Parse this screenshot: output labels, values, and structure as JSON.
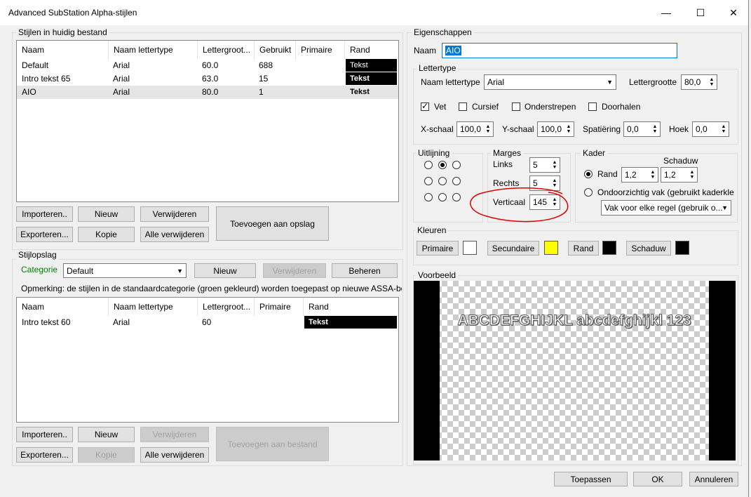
{
  "window": {
    "title": "Advanced SubStation Alpha-stijlen",
    "minimize": "—",
    "maximize": "☐",
    "close": "✕"
  },
  "styles_in_file": {
    "group_label": "Stijlen in huidig bestand",
    "headers": [
      "Naam",
      "Naam lettertype",
      "Lettergroot...",
      "Gebruikt",
      "Primaire",
      "Rand"
    ],
    "rows": [
      {
        "name": "Default",
        "font": "Arial",
        "size": "60.0",
        "used": "688",
        "primary": "",
        "border": "Tekst"
      },
      {
        "name": "Intro tekst 65",
        "font": "Arial",
        "size": "63.0",
        "used": "15",
        "primary": "",
        "border": "Tekst"
      },
      {
        "name": "AIO",
        "font": "Arial",
        "size": "80.0",
        "used": "1",
        "primary": "",
        "border": "Tekst"
      }
    ],
    "buttons": {
      "import": "Importeren..",
      "new": "Nieuw",
      "delete": "Verwijderen",
      "add_to_storage": "Toevoegen aan opslag",
      "export": "Exporteren...",
      "copy": "Kopie",
      "delete_all": "Alle verwijderen"
    }
  },
  "storage": {
    "group_label": "Stijlopslag",
    "category_label": "Categorie",
    "category_value": "Default",
    "new": "Nieuw",
    "delete": "Verwijderen",
    "manage": "Beheren",
    "note": "Opmerking: de stijlen in de standaardcategorie (groen gekleurd) worden toegepast op nieuwe ASSA-bes",
    "headers": [
      "Naam",
      "Naam lettertype",
      "Lettergroot...",
      "Primaire",
      "Rand"
    ],
    "rows": [
      {
        "name": "Intro tekst 60",
        "font": "Arial",
        "size": "60",
        "primary": "",
        "border": "Tekst"
      }
    ],
    "buttons": {
      "import": "Importeren..",
      "new": "Nieuw",
      "delete": "Verwijderen",
      "add_to_file": "Toevoegen aan bestand",
      "export": "Exporteren...",
      "copy": "Kopie",
      "delete_all": "Alle verwijderen"
    }
  },
  "properties": {
    "group_label": "Eigenschappen",
    "name_label": "Naam",
    "name_value": "AIO",
    "font": {
      "group_label": "Lettertype",
      "font_name_label": "Naam lettertype",
      "font_name_value": "Arial",
      "font_size_label": "Lettergrootte",
      "font_size_value": "80,0",
      "bold": "Vet",
      "italic": "Cursief",
      "underline": "Onderstrepen",
      "strikeout": "Doorhalen",
      "x_scale_label": "X-schaal",
      "x_scale_value": "100,0",
      "y_scale_label": "Y-schaal",
      "y_scale_value": "100,0",
      "spacing_label": "Spatiëring",
      "spacing_value": "0,0",
      "angle_label": "Hoek",
      "angle_value": "0,0"
    },
    "alignment": {
      "group_label": "Uitlijning"
    },
    "margins": {
      "group_label": "Marges",
      "left_label": "Links",
      "left_value": "5",
      "right_label": "Rechts",
      "right_value": "5",
      "vertical_label": "Verticaal",
      "vertical_value": "145"
    },
    "border": {
      "group_label": "Kader",
      "shadow_label": "Schaduw",
      "outline_label": "Rand",
      "outline_value": "1,2",
      "shadow_value": "1,2",
      "opaque_label": "Ondoorzichtig vak (gebruikt kaderkle",
      "box_option": "Vak voor elke regel (gebruik o..."
    },
    "colors": {
      "group_label": "Kleuren",
      "primary": "Primaire",
      "secondary": "Secundaire",
      "outline": "Rand",
      "shadow": "Schaduw",
      "primary_color": "#ffffff",
      "secondary_color": "#ffff00",
      "outline_color": "#000000",
      "shadow_color": "#000000"
    },
    "preview": {
      "group_label": "Voorbeeld",
      "text": "ABCDEFGHIJKL abcdefghijkl 123"
    }
  },
  "footer": {
    "apply": "Toepassen",
    "ok": "OK",
    "cancel": "Annuleren"
  }
}
